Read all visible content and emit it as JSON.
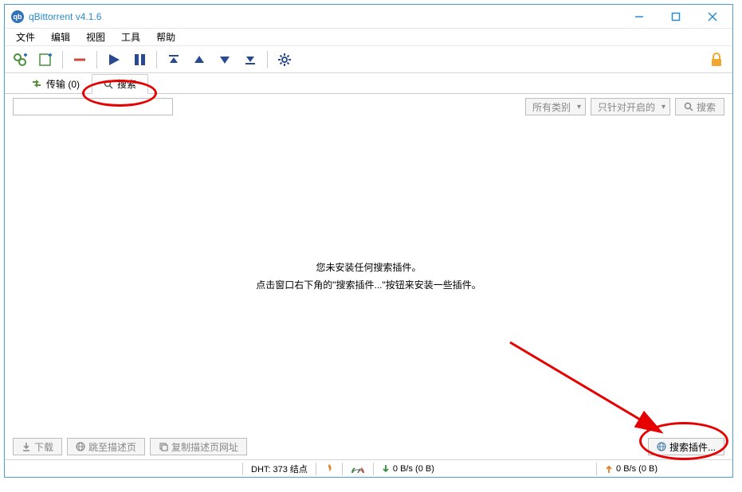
{
  "window": {
    "title": "qBittorrent v4.1.6"
  },
  "menu": {
    "file": "文件",
    "edit": "编辑",
    "view": "视图",
    "tools": "工具",
    "help": "帮助"
  },
  "tabs": {
    "transfer": "传输 (0)",
    "search": "搜索"
  },
  "search": {
    "placeholder": "",
    "category": "所有类别",
    "scope": "只针对开启的",
    "button": "搜索"
  },
  "empty": {
    "line1": "您未安装任何搜索插件。",
    "line2": "点击窗口右下角的\"搜索插件...\"按钮来安装一些插件。"
  },
  "bottom": {
    "download": "下载",
    "goto_desc": "跳至描述页",
    "copy_desc_url": "复制描述页网址",
    "search_plugins": "搜索插件..."
  },
  "status": {
    "dht": "DHT: 373 结点",
    "down": "0  B/s (0  B)",
    "up": "0  B/s (0  B)"
  }
}
